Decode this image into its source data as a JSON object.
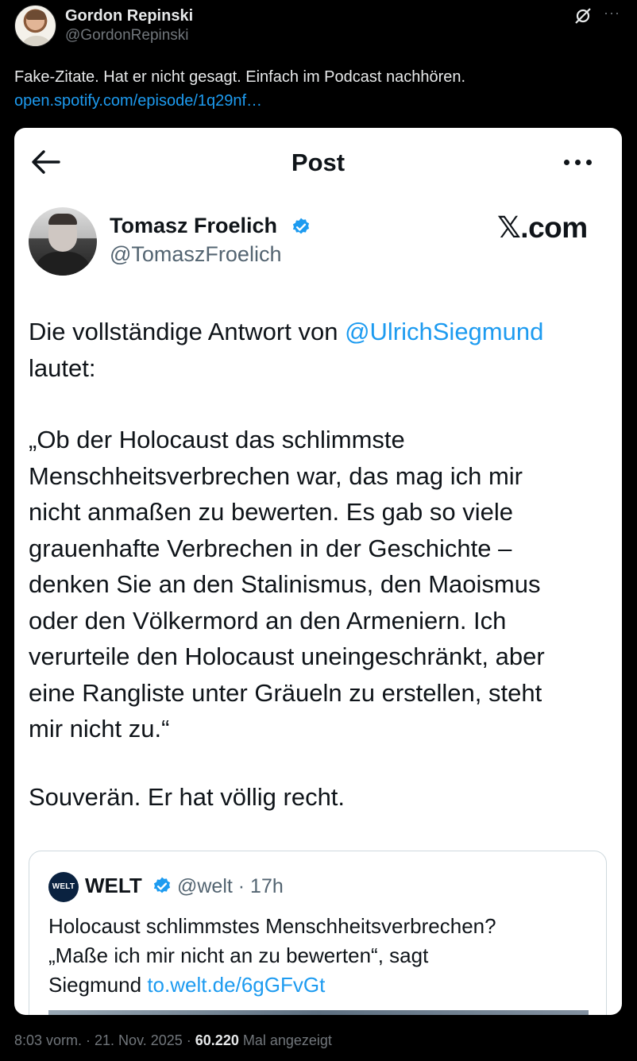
{
  "outer": {
    "author_name": "Gordon Repinski",
    "author_handle": "@GordonRepinski",
    "text": "Fake-Zitate. Hat er nicht gesagt. Einfach im Podcast nachhören.",
    "link": "open.spotify.com/episode/1q29nf…",
    "more_label": "···"
  },
  "card": {
    "title": "Post",
    "author_name": "Tomasz Froelich",
    "author_handle": "@TomaszFroelich",
    "brand": "𝕏.com",
    "line1_prefix": "Die vollständige Antwort von ",
    "line1_mention": "@UlrichSiegmund",
    "line2": "lautet:",
    "quote_lines": [
      "„Ob der Holocaust das schlimmste",
      "Menschheitsverbrechen war, das mag ich mir",
      "nicht anmaßen zu bewerten. Es gab so viele",
      "grauenhafte Verbrechen in der Geschichte –",
      "denken Sie an den Stalinismus, den Maoismus",
      "oder den Völkermord an den Armeniern. Ich",
      "verurteile den Holocaust uneingeschränkt, aber",
      "eine Rangliste unter Gräueln zu erstellen, steht",
      "mir nicht zu.“"
    ],
    "closing": "Souverän. Er hat völlig recht."
  },
  "quoted": {
    "logo_text": "WELT",
    "name": "WELT",
    "handle_time": "@welt · 17h",
    "line1": "Holocaust schlimmstes Menschheitsverbrechen?",
    "line2": "„Maße ich mir nicht an zu bewerten“, sagt",
    "line3_prefix": "Siegmund ",
    "line3_link": "to.welt.de/6gGFvGt"
  },
  "footer": {
    "time_date": "8:03 vorm. · 21. Nov. 2025 · ",
    "views_count": "60.220",
    "views_label": " Mal angezeigt"
  },
  "colors": {
    "background": "#000000",
    "link": "#1d9bf0",
    "muted": "#71767b",
    "verified": "#1d9bf0"
  }
}
